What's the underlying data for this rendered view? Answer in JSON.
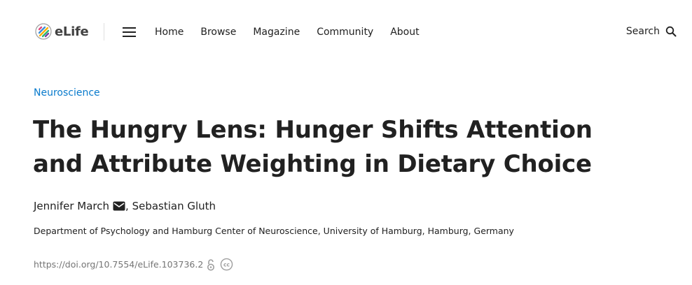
{
  "header": {
    "logo_text": "eLife",
    "nav": [
      {
        "label": "Home"
      },
      {
        "label": "Browse"
      },
      {
        "label": "Magazine"
      },
      {
        "label": "Community"
      },
      {
        "label": "About"
      }
    ],
    "search_label": "Search",
    "icons": {
      "logo": "elife-logo-icon",
      "menu": "hamburger-menu-icon",
      "search": "magnifier-search-icon"
    }
  },
  "article": {
    "subject": "Neuroscience",
    "title": "The Hungry Lens: Hunger Shifts Attention and Attribute Weighting in Dietary Choice",
    "authors": [
      {
        "name": "Jennifer March",
        "corresponding": true
      },
      {
        "name": "Sebastian Gluth",
        "corresponding": false
      }
    ],
    "author_separator": ", ",
    "affiliation": "Department of Psychology and Hamburg Center of Neuroscience, University of Hamburg, Hamburg, Germany",
    "doi": "https://doi.org/10.7554/eLife.103736.2",
    "icons": {
      "email": "envelope-icon",
      "open_access": "open-access-lock-icon",
      "license": "creative-commons-icon"
    }
  },
  "colors": {
    "text": "#212121",
    "link_blue": "#087acc",
    "muted": "#757575",
    "divider": "#e0e0e0"
  }
}
